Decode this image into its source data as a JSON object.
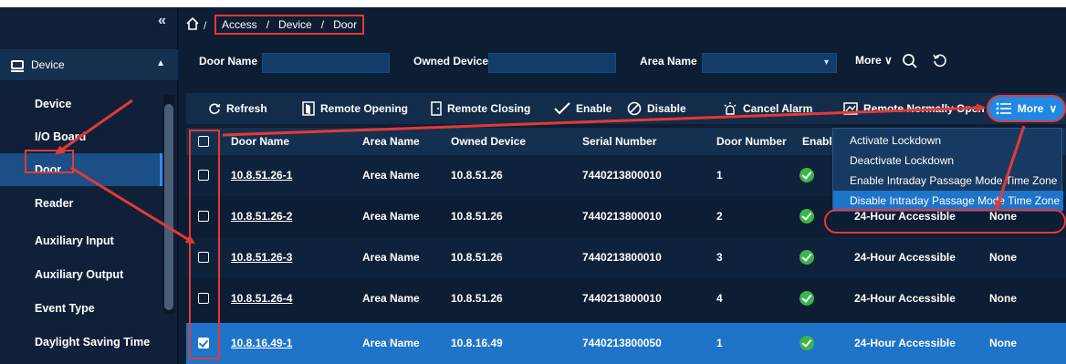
{
  "sidebar": {
    "collapse": "«",
    "header": "Device",
    "header_caret": "▲",
    "items": [
      {
        "label": "Device"
      },
      {
        "label": "I/O Board"
      },
      {
        "label": "Door"
      },
      {
        "label": "Reader"
      },
      {
        "label": "Auxiliary Input"
      },
      {
        "label": "Auxiliary Output"
      },
      {
        "label": "Event Type"
      },
      {
        "label": "Daylight Saving Time"
      }
    ]
  },
  "breadcrumb": {
    "sep0": "/",
    "items": [
      "Access",
      "/",
      "Device",
      "/",
      "Door"
    ]
  },
  "filter": {
    "door_name_label": "Door Name",
    "owned_device_label": "Owned Device",
    "area_name_label": "Area Name",
    "area_chevron": "▾",
    "more_label": "More",
    "more_chevron": "∨"
  },
  "toolbar": {
    "refresh": "Refresh",
    "remote_opening": "Remote Opening",
    "remote_closing": "Remote Closing",
    "enable": "Enable",
    "disable": "Disable",
    "cancel_alarm": "Cancel Alarm",
    "remote_normally_open": "Remote Normally Open",
    "more": "More",
    "more_chevron": "∨"
  },
  "table": {
    "headers": {
      "door_name": "Door Name",
      "area_name": "Area Name",
      "owned_device": "Owned Device",
      "serial_number": "Serial Number",
      "door_number": "Door Number",
      "enable": "Enable"
    },
    "rows": [
      {
        "door_name": "10.8.51.26-1",
        "area_name": "Area Name",
        "owned_device": "10.8.51.26",
        "serial_number": "7440213800010",
        "door_number": "1",
        "mode": "",
        "extra": "",
        "checked": false
      },
      {
        "door_name": "10.8.51.26-2",
        "area_name": "Area Name",
        "owned_device": "10.8.51.26",
        "serial_number": "7440213800010",
        "door_number": "2",
        "mode": "24-Hour Accessible",
        "extra": "None",
        "checked": false
      },
      {
        "door_name": "10.8.51.26-3",
        "area_name": "Area Name",
        "owned_device": "10.8.51.26",
        "serial_number": "7440213800010",
        "door_number": "3",
        "mode": "24-Hour Accessible",
        "extra": "None",
        "checked": false
      },
      {
        "door_name": "10.8.51.26-4",
        "area_name": "Area Name",
        "owned_device": "10.8.51.26",
        "serial_number": "7440213800010",
        "door_number": "4",
        "mode": "24-Hour Accessible",
        "extra": "None",
        "checked": false
      },
      {
        "door_name": "10.8.16.49-1",
        "area_name": "Area Name",
        "owned_device": "10.8.16.49",
        "serial_number": "7440213800050",
        "door_number": "1",
        "mode": "24-Hour Accessible",
        "extra": "None",
        "checked": true
      }
    ]
  },
  "dropdown": {
    "items": [
      "Activate Lockdown",
      "Deactivate Lockdown",
      "Enable Intraday Passage Mode Time Zone",
      "Disable Intraday Passage Mode Time Zone"
    ]
  },
  "colors": {
    "accent": "#1e88e5",
    "annotation": "#e53935",
    "success": "#3bb54a",
    "selected_row": "#1e74c8"
  }
}
